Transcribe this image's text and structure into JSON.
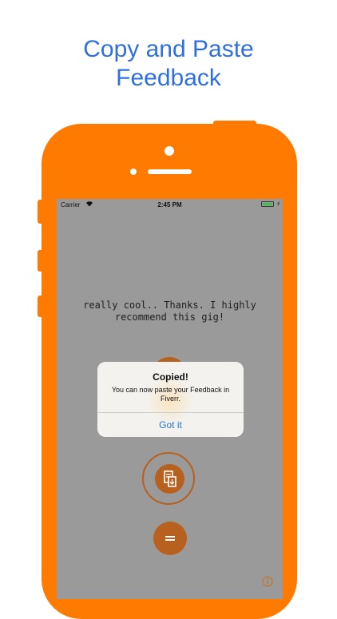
{
  "headline": {
    "line1": "Copy and Paste",
    "line2": "Feedback"
  },
  "status_bar": {
    "carrier": "Carrier",
    "time": "2:45 PM",
    "wifi_icon": "wifi-icon",
    "battery_icon": "battery-icon",
    "charging_icon": "bolt-icon"
  },
  "feedback_text": "really cool.. Thanks. I highly recommend this gig!",
  "alert": {
    "title": "Copied!",
    "message": "You can now paste your Feedback in Fiverr.",
    "action": "Got it"
  },
  "buttons": {
    "paste_icon": "paste-icon",
    "menu_icon": "equals-icon",
    "info_icon": "info-icon"
  },
  "colors": {
    "phone": "#ff7a00",
    "screen_bg": "#9a9a9a",
    "button": "#b8601e",
    "headline": "#2f6fe0",
    "alert_action": "#2a74d8"
  }
}
